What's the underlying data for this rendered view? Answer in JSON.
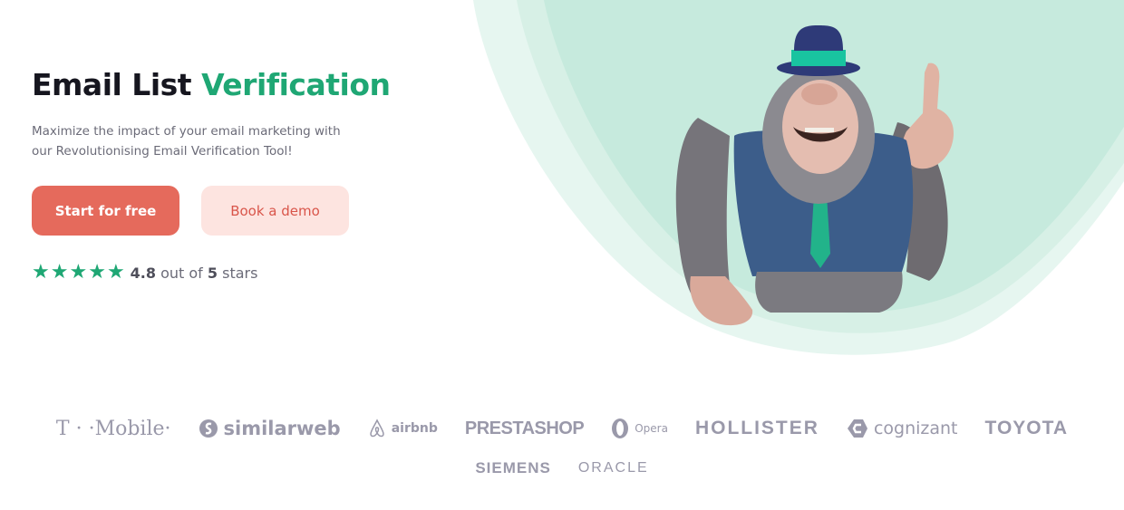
{
  "hero": {
    "title_main": "Email List ",
    "title_accent": "Verification",
    "subtitle": "Maximize the impact of your email marketing with our Revolutionising Email Verification Tool!",
    "primary_button": "Start for free",
    "secondary_button": "Book a demo",
    "rating": {
      "stars_filled": 5,
      "stars_total": 5,
      "score": "4.8",
      "mid_text": " out of ",
      "max": "5",
      "suffix": " stars"
    },
    "mascot": "gorilla-mascot-in-hat-and-vest"
  },
  "colors": {
    "accent_green": "#1fa774",
    "primary_button": "#e56a5c",
    "secondary_button_bg": "#fde4e0",
    "title": "#16161f",
    "logo_gray": "#9a99aa",
    "bg_mint": "#c6eadd"
  },
  "logos": {
    "row1": [
      "T · ·Mobile·",
      "similarweb",
      "airbnb",
      "PRESTASHOP",
      "Opera",
      "HOLLISTER",
      "cognizant",
      "TOYOTA"
    ],
    "row2": [
      "SIEMENS",
      "ORACLE"
    ]
  }
}
